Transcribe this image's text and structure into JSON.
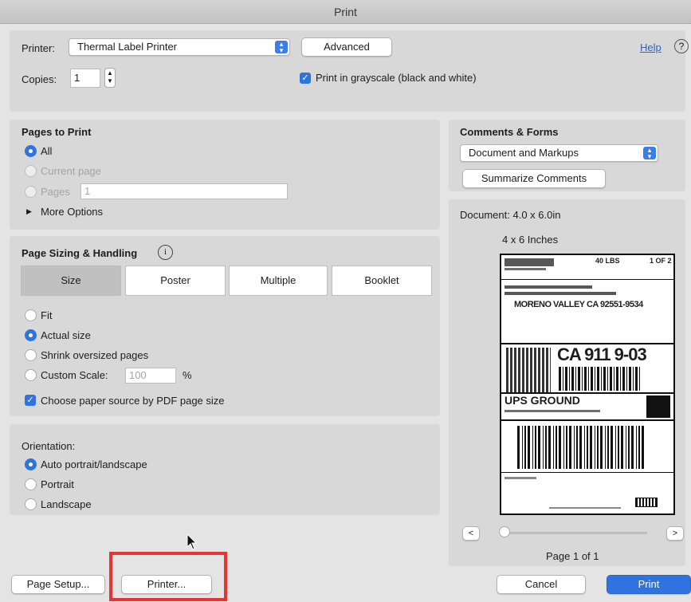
{
  "window": {
    "title": "Print"
  },
  "printer": {
    "label": "Printer:",
    "value": "Thermal Label Printer",
    "advanced": "Advanced",
    "help": "Help"
  },
  "copies": {
    "label": "Copies:",
    "value": "1"
  },
  "grayscale": {
    "label": "Print in grayscale (black and white)",
    "checked": true
  },
  "pages": {
    "heading": "Pages to Print",
    "all": "All",
    "current": "Current page",
    "pages_label": "Pages",
    "pages_value": "1",
    "more": "More Options",
    "selected": "All"
  },
  "sizing": {
    "heading": "Page Sizing & Handling",
    "tabs": [
      "Size",
      "Poster",
      "Multiple",
      "Booklet"
    ],
    "selected_tab": "Size",
    "fit": "Fit",
    "actual": "Actual size",
    "shrink": "Shrink oversized pages",
    "custom": "Custom Scale:",
    "custom_value": "100",
    "percent": "%",
    "paper_source": "Choose paper source by PDF page size",
    "selected": "Actual size",
    "paper_source_checked": true
  },
  "orientation": {
    "heading": "Orientation:",
    "auto": "Auto portrait/landscape",
    "portrait": "Portrait",
    "landscape": "Landscape",
    "selected": "Auto portrait/landscape"
  },
  "comments": {
    "heading": "Comments & Forms",
    "value": "Document and Markups",
    "summarize": "Summarize Comments"
  },
  "preview": {
    "document": "Document: 4.0 x 6.0in",
    "size_label": "4 x 6 Inches",
    "page": "Page 1 of 1",
    "prev": "<",
    "next": ">",
    "slider_position": 0
  },
  "label": {
    "top_right": "1 OF 2",
    "lbs": "40 LBS",
    "city": "MORENO VALLEY CA 92551-9534",
    "code": "CA 911 9-03",
    "service": "UPS GROUND"
  },
  "footer": {
    "page_setup": "Page Setup...",
    "printer": "Printer...",
    "cancel": "Cancel",
    "print": "Print"
  },
  "colors": {
    "accent": "#2f73e0",
    "highlight_box": "#e53434"
  }
}
